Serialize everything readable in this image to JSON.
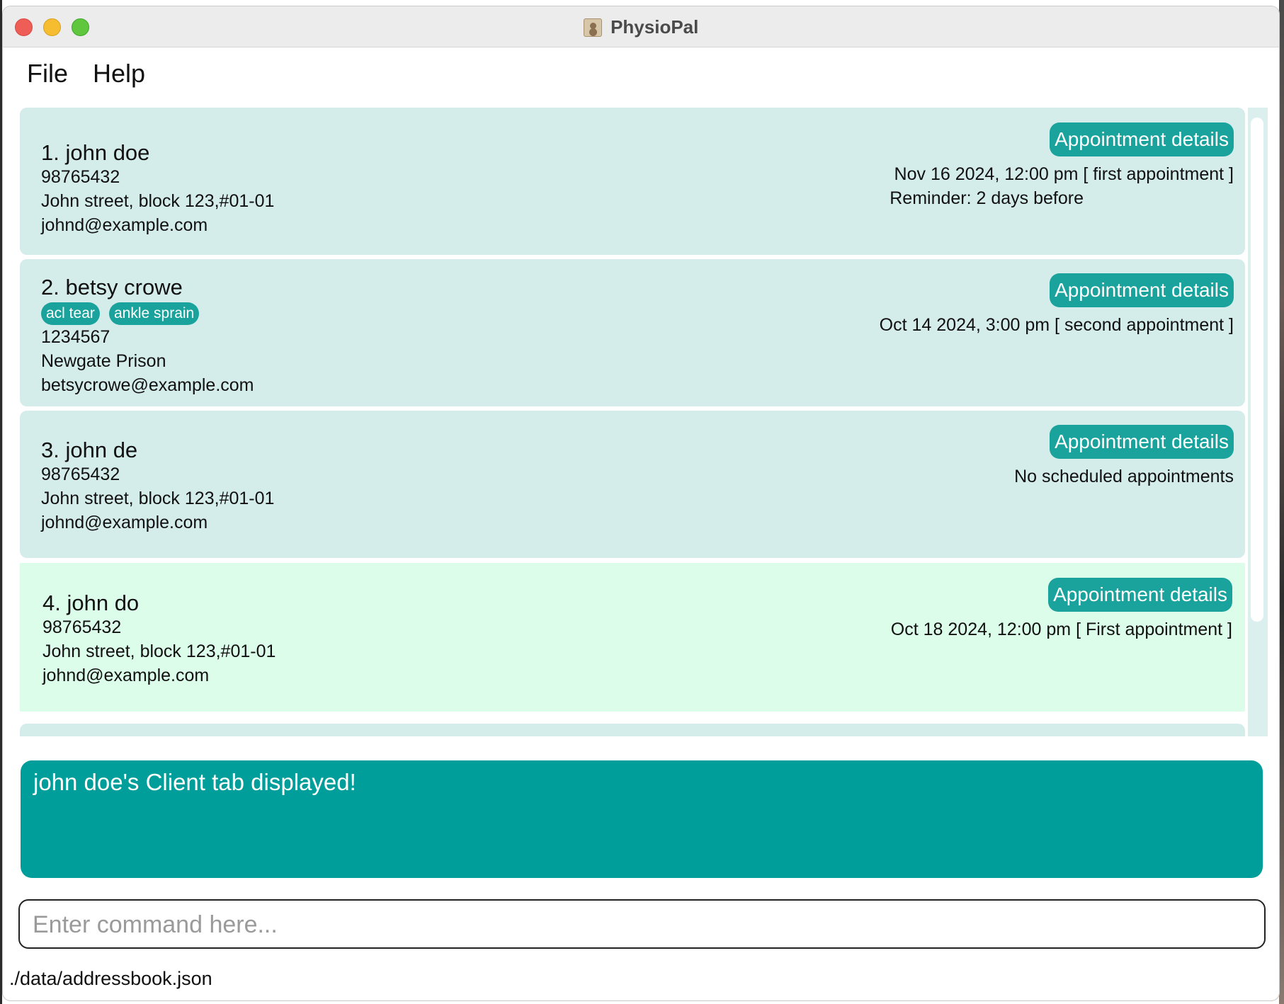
{
  "window": {
    "title": "PhysioPal"
  },
  "menu": {
    "file": "File",
    "help": "Help"
  },
  "clients": [
    {
      "name": "1. john doe",
      "tags": [],
      "phone": "98765432",
      "address": "John street, block 123,#01-01",
      "email": "johnd@example.com",
      "appointment_button": "Appointment details",
      "appointment": "Nov 16 2024, 12:00 pm [ first appointment ]",
      "reminder": "Reminder: 2 days before"
    },
    {
      "name": "2. betsy crowe",
      "tags": [
        "acl tear",
        "ankle sprain"
      ],
      "phone": "1234567",
      "address": "Newgate Prison",
      "email": "betsycrowe@example.com",
      "appointment_button": "Appointment details",
      "appointment": "Oct 14 2024, 3:00 pm [ second appointment ]"
    },
    {
      "name": "3. john de",
      "tags": [],
      "phone": "98765432",
      "address": "John street, block 123,#01-01",
      "email": "johnd@example.com",
      "appointment_button": "Appointment details",
      "appointment": "No scheduled appointments"
    },
    {
      "name": "4. john do",
      "tags": [],
      "phone": "98765432",
      "address": "John street, block 123,#01-01",
      "email": "johnd@example.com",
      "appointment_button": "Appointment details",
      "appointment": "Oct 18 2024, 12:00 pm [ First appointment ]"
    }
  ],
  "result": {
    "message": "john doe's Client tab displayed!"
  },
  "command": {
    "placeholder": "Enter command here...",
    "value": ""
  },
  "status": {
    "file_path": "./data/addressbook.json"
  },
  "colors": {
    "accent": "#009e9a",
    "card": "#d4ecea",
    "selected_card": "#dcfdea",
    "tag": "#1aa39c"
  }
}
